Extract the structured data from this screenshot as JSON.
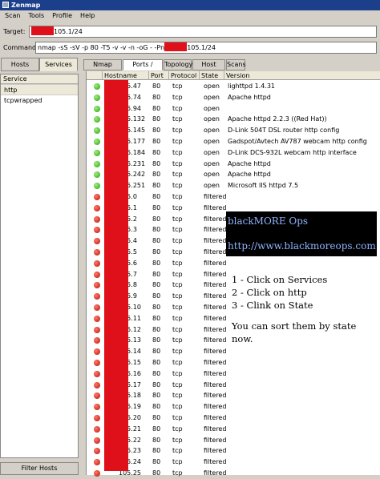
{
  "window": {
    "title": "Zenmap"
  },
  "menu": [
    "Scan",
    "Tools",
    "Profile",
    "Help"
  ],
  "target": {
    "label": "Target:",
    "value": "105.1/24"
  },
  "command": {
    "label": "Command:",
    "prefix": "nmap -sS -sV -p 80 -T5 -v -v -n -oG - -Pn",
    "suffix": "105.1/24"
  },
  "sidebar": {
    "hosts_label": "Hosts",
    "services_label": "Services",
    "service_header": "Service",
    "services": [
      "http",
      "tcpwrapped"
    ],
    "filter_label": "Filter Hosts"
  },
  "tabs": [
    "Nmap Output",
    "Ports / Hosts",
    "Topology",
    "Host Details",
    "Scans"
  ],
  "columns": [
    "Hostname",
    "Port",
    "Protocol",
    "State",
    "Version"
  ],
  "rows": [
    {
      "status": "green",
      "host": "105.47",
      "port": "80",
      "proto": "tcp",
      "state": "open",
      "version": "lighttpd 1.4.31"
    },
    {
      "status": "green",
      "host": "105.74",
      "port": "80",
      "proto": "tcp",
      "state": "open",
      "version": "Apache httpd"
    },
    {
      "status": "green",
      "host": "105.94",
      "port": "80",
      "proto": "tcp",
      "state": "open",
      "version": ""
    },
    {
      "status": "green",
      "host": "105.132",
      "port": "80",
      "proto": "tcp",
      "state": "open",
      "version": "Apache httpd 2.2.3 ((Red Hat))"
    },
    {
      "status": "green",
      "host": "105.145",
      "port": "80",
      "proto": "tcp",
      "state": "open",
      "version": "D-Link 504T DSL router http config"
    },
    {
      "status": "green",
      "host": "105.177",
      "port": "80",
      "proto": "tcp",
      "state": "open",
      "version": "Gadspot/Avtech AV787 webcam http config"
    },
    {
      "status": "green",
      "host": "105.184",
      "port": "80",
      "proto": "tcp",
      "state": "open",
      "version": "D-Link DCS-932L webcam http interface"
    },
    {
      "status": "green",
      "host": "105.231",
      "port": "80",
      "proto": "tcp",
      "state": "open",
      "version": "Apache httpd"
    },
    {
      "status": "green",
      "host": "105.242",
      "port": "80",
      "proto": "tcp",
      "state": "open",
      "version": "Apache httpd"
    },
    {
      "status": "green",
      "host": "105.251",
      "port": "80",
      "proto": "tcp",
      "state": "open",
      "version": "Microsoft IIS httpd 7.5"
    },
    {
      "status": "red",
      "host": "105.0",
      "port": "80",
      "proto": "tcp",
      "state": "filtered",
      "version": ""
    },
    {
      "status": "red",
      "host": "105.1",
      "port": "80",
      "proto": "tcp",
      "state": "filtered",
      "version": ""
    },
    {
      "status": "red",
      "host": "105.2",
      "port": "80",
      "proto": "tcp",
      "state": "filtered",
      "version": ""
    },
    {
      "status": "red",
      "host": "105.3",
      "port": "80",
      "proto": "tcp",
      "state": "filtered",
      "version": ""
    },
    {
      "status": "red",
      "host": "105.4",
      "port": "80",
      "proto": "tcp",
      "state": "filtered",
      "version": ""
    },
    {
      "status": "red",
      "host": "105.5",
      "port": "80",
      "proto": "tcp",
      "state": "filtered",
      "version": ""
    },
    {
      "status": "red",
      "host": "105.6",
      "port": "80",
      "proto": "tcp",
      "state": "filtered",
      "version": ""
    },
    {
      "status": "red",
      "host": "105.7",
      "port": "80",
      "proto": "tcp",
      "state": "filtered",
      "version": ""
    },
    {
      "status": "red",
      "host": "105.8",
      "port": "80",
      "proto": "tcp",
      "state": "filtered",
      "version": ""
    },
    {
      "status": "red",
      "host": "105.9",
      "port": "80",
      "proto": "tcp",
      "state": "filtered",
      "version": ""
    },
    {
      "status": "red",
      "host": "105.10",
      "port": "80",
      "proto": "tcp",
      "state": "filtered",
      "version": ""
    },
    {
      "status": "red",
      "host": "105.11",
      "port": "80",
      "proto": "tcp",
      "state": "filtered",
      "version": ""
    },
    {
      "status": "red",
      "host": "105.12",
      "port": "80",
      "proto": "tcp",
      "state": "filtered",
      "version": ""
    },
    {
      "status": "red",
      "host": "105.13",
      "port": "80",
      "proto": "tcp",
      "state": "filtered",
      "version": ""
    },
    {
      "status": "red",
      "host": "105.14",
      "port": "80",
      "proto": "tcp",
      "state": "filtered",
      "version": ""
    },
    {
      "status": "red",
      "host": "105.15",
      "port": "80",
      "proto": "tcp",
      "state": "filtered",
      "version": ""
    },
    {
      "status": "red",
      "host": "105.16",
      "port": "80",
      "proto": "tcp",
      "state": "filtered",
      "version": ""
    },
    {
      "status": "red",
      "host": "105.17",
      "port": "80",
      "proto": "tcp",
      "state": "filtered",
      "version": ""
    },
    {
      "status": "red",
      "host": "105.18",
      "port": "80",
      "proto": "tcp",
      "state": "filtered",
      "version": ""
    },
    {
      "status": "red",
      "host": "105.19",
      "port": "80",
      "proto": "tcp",
      "state": "filtered",
      "version": ""
    },
    {
      "status": "red",
      "host": "105.20",
      "port": "80",
      "proto": "tcp",
      "state": "filtered",
      "version": ""
    },
    {
      "status": "red",
      "host": "105.21",
      "port": "80",
      "proto": "tcp",
      "state": "filtered",
      "version": ""
    },
    {
      "status": "red",
      "host": "105.22",
      "port": "80",
      "proto": "tcp",
      "state": "filtered",
      "version": ""
    },
    {
      "status": "red",
      "host": "105.23",
      "port": "80",
      "proto": "tcp",
      "state": "filtered",
      "version": ""
    },
    {
      "status": "red",
      "host": "105.24",
      "port": "80",
      "proto": "tcp",
      "state": "filtered",
      "version": ""
    },
    {
      "status": "red",
      "host": "105.25",
      "port": "80",
      "proto": "tcp",
      "state": "filtered",
      "version": ""
    }
  ],
  "overlay": {
    "brand": "blackMORE Ops",
    "url": "http://www.blackmoreops.com",
    "steps": [
      "1 - Click on Services",
      "2 - Click on http",
      "3 - Clink on State"
    ],
    "note": "You can sort them by state now."
  },
  "colors": {
    "open": "#28a010",
    "filtered": "#b81008",
    "redaction": "#e0101a",
    "titlebar": "#1c3f8c"
  }
}
